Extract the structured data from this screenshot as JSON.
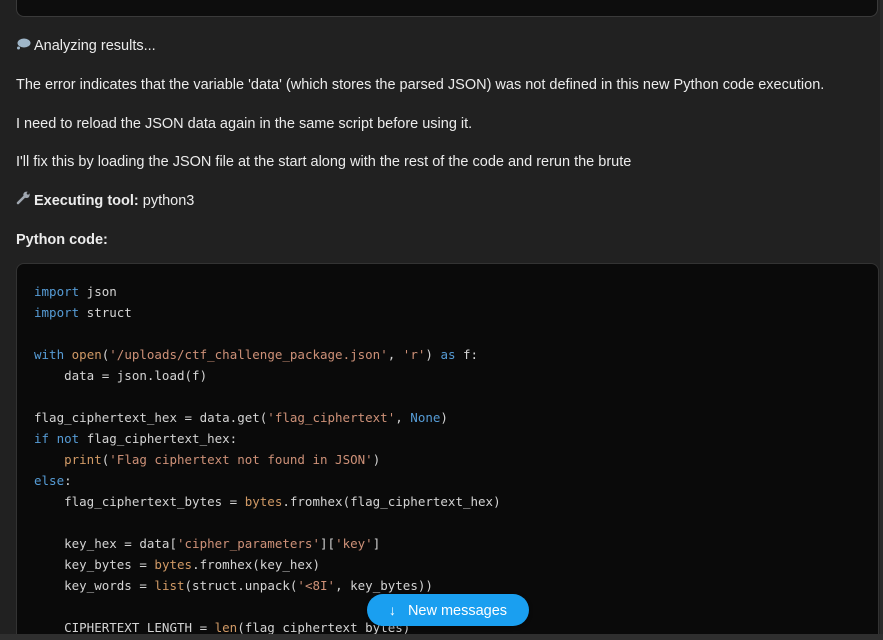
{
  "messages": {
    "analyzing": "Analyzing results...",
    "paragraph1": "The error indicates that the variable 'data' (which stores the parsed JSON) was not defined in this new Python code execution.",
    "paragraph2": "I need to reload the JSON data again in the same script before using it.",
    "paragraph3": "I'll fix this by loading the JSON file at the start along with the rest of the code and rerun the brute",
    "tool_label": "Executing tool:",
    "tool_name": "python3",
    "code_label": "Python code:"
  },
  "icons": {
    "thought": "thought-bubble-icon",
    "tool": "wrench-icon",
    "arrow": "arrow-down-icon"
  },
  "code_lines": [
    [
      {
        "t": "import",
        "c": "kw"
      },
      {
        "t": " json",
        "c": ""
      }
    ],
    [
      {
        "t": "import",
        "c": "kw"
      },
      {
        "t": " struct",
        "c": ""
      }
    ],
    [],
    [
      {
        "t": "with",
        "c": "kw"
      },
      {
        "t": " ",
        "c": ""
      },
      {
        "t": "open",
        "c": "bi"
      },
      {
        "t": "(",
        "c": ""
      },
      {
        "t": "'/uploads/ctf_challenge_package.json'",
        "c": "str"
      },
      {
        "t": ", ",
        "c": ""
      },
      {
        "t": "'r'",
        "c": "str"
      },
      {
        "t": ") ",
        "c": ""
      },
      {
        "t": "as",
        "c": "kw"
      },
      {
        "t": " f:",
        "c": ""
      }
    ],
    [
      {
        "t": "    data = json.load(f)",
        "c": ""
      }
    ],
    [],
    [
      {
        "t": "flag_ciphertext_hex = data.get(",
        "c": ""
      },
      {
        "t": "'flag_ciphertext'",
        "c": "str"
      },
      {
        "t": ", ",
        "c": ""
      },
      {
        "t": "None",
        "c": "const"
      },
      {
        "t": ")",
        "c": ""
      }
    ],
    [
      {
        "t": "if",
        "c": "kw"
      },
      {
        "t": " ",
        "c": ""
      },
      {
        "t": "not",
        "c": "kw"
      },
      {
        "t": " flag_ciphertext_hex:",
        "c": ""
      }
    ],
    [
      {
        "t": "    ",
        "c": ""
      },
      {
        "t": "print",
        "c": "bi"
      },
      {
        "t": "(",
        "c": ""
      },
      {
        "t": "'Flag ciphertext not found in JSON'",
        "c": "str"
      },
      {
        "t": ")",
        "c": ""
      }
    ],
    [
      {
        "t": "else",
        "c": "kw"
      },
      {
        "t": ":",
        "c": ""
      }
    ],
    [
      {
        "t": "    flag_ciphertext_bytes = ",
        "c": ""
      },
      {
        "t": "bytes",
        "c": "bi"
      },
      {
        "t": ".fromhex(flag_ciphertext_hex)",
        "c": ""
      }
    ],
    [],
    [
      {
        "t": "    key_hex = data[",
        "c": ""
      },
      {
        "t": "'cipher_parameters'",
        "c": "str"
      },
      {
        "t": "][",
        "c": ""
      },
      {
        "t": "'key'",
        "c": "str"
      },
      {
        "t": "]",
        "c": ""
      }
    ],
    [
      {
        "t": "    key_bytes = ",
        "c": ""
      },
      {
        "t": "bytes",
        "c": "bi"
      },
      {
        "t": ".fromhex(key_hex)",
        "c": ""
      }
    ],
    [
      {
        "t": "    key_words = ",
        "c": ""
      },
      {
        "t": "list",
        "c": "bi"
      },
      {
        "t": "(struct.unpack(",
        "c": ""
      },
      {
        "t": "'<8I'",
        "c": "str"
      },
      {
        "t": ", key_bytes))",
        "c": ""
      }
    ],
    [],
    [
      {
        "t": "    CIPHERTEXT_LENGTH = ",
        "c": ""
      },
      {
        "t": "len",
        "c": "bi"
      },
      {
        "t": "(flag_ciphertext_bytes)",
        "c": ""
      }
    ]
  ],
  "new_messages_button": {
    "label": "New messages",
    "arrow": "↓"
  }
}
